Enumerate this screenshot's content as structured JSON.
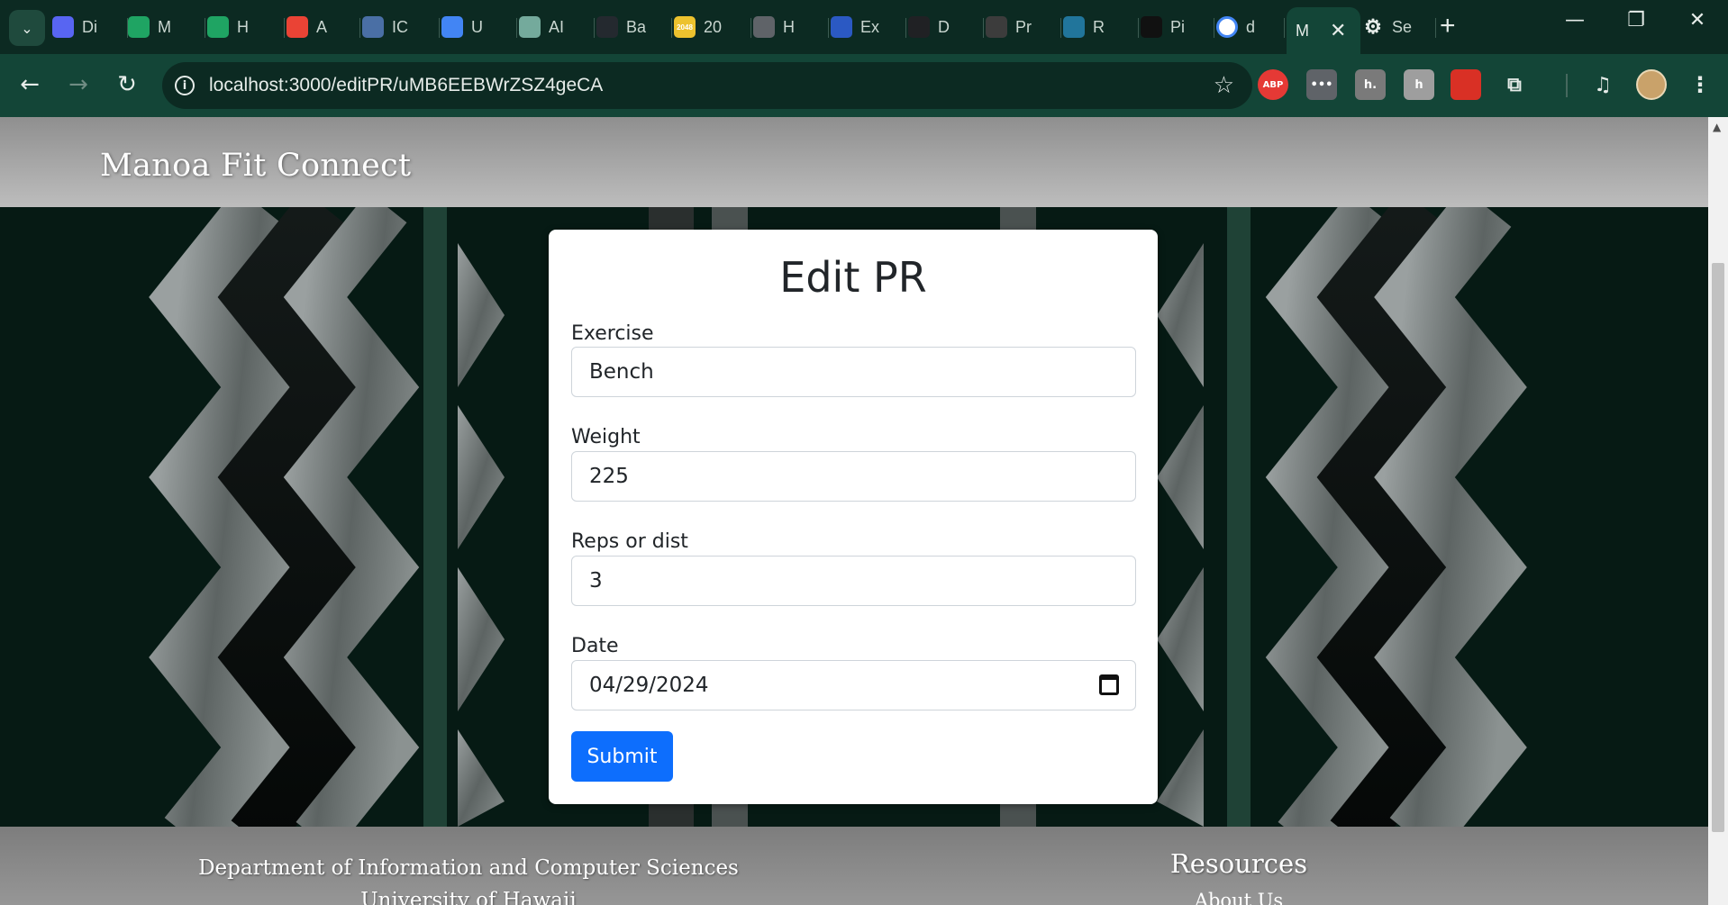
{
  "browser": {
    "tabs": [
      {
        "label": "Di",
        "icon": "discord-icon",
        "color": "#5865f2"
      },
      {
        "label": "M",
        "icon": "google-drive-icon",
        "color": "#1fa463"
      },
      {
        "label": "H",
        "icon": "google-drive-icon",
        "color": "#1fa463"
      },
      {
        "label": "A",
        "icon": "gmail-icon",
        "color": "#ea4335"
      },
      {
        "label": "IC",
        "icon": "document-icon",
        "color": "#4a6fa5"
      },
      {
        "label": "U",
        "icon": "google-docs-icon",
        "color": "#4285f4"
      },
      {
        "label": "AI",
        "icon": "chatgpt-icon",
        "color": "#74aa9c"
      },
      {
        "label": "Ba",
        "icon": "github-icon",
        "color": "#24292f"
      },
      {
        "label": "20",
        "icon": "2048-icon",
        "color": "#edc22e"
      },
      {
        "label": "H",
        "icon": "globe-icon",
        "color": "#5f6368"
      },
      {
        "label": "Ex",
        "icon": "runner-icon",
        "color": "#2b59c3"
      },
      {
        "label": "D",
        "icon": "skull-icon",
        "color": "#202124"
      },
      {
        "label": "Pr",
        "icon": "panther-icon",
        "color": "#3c3c3c"
      },
      {
        "label": "R",
        "icon": "wordpress-icon",
        "color": "#21759b"
      },
      {
        "label": "Pi",
        "icon": "p-icon",
        "color": "#111111"
      },
      {
        "label": "d",
        "icon": "google-icon",
        "color": "#ffffff"
      },
      {
        "label": "M",
        "icon": "active-tab",
        "color": "#134537",
        "active": true
      },
      {
        "label": "Se",
        "icon": "gear-icon",
        "color": "#5f6368"
      }
    ],
    "tab_2048_text": "2048",
    "url": "localhost:3000/editPR/uMB6EEBWrZSZ4geCA",
    "extensions": [
      {
        "name": "adblock-plus-icon",
        "text": "ABP",
        "color": "#e53935"
      },
      {
        "name": "password-dots-icon",
        "text": "•••",
        "color": "#5f6368"
      },
      {
        "name": "honey-icon",
        "text": "h.",
        "color": "#7a7a7a"
      },
      {
        "name": "h-badge-icon",
        "text": "h",
        "color": "#9e9e9e"
      },
      {
        "name": "red-extension-icon",
        "text": "",
        "color": "#d93025"
      },
      {
        "name": "puzzle-icon",
        "text": "",
        "color": "transparent"
      }
    ]
  },
  "site": {
    "brand": "Manoa Fit Connect"
  },
  "form": {
    "title": "Edit PR",
    "exercise_label": "Exercise",
    "exercise_value": "Bench",
    "weight_label": "Weight",
    "weight_value": "225",
    "reps_label": "Reps or dist",
    "reps_value": "3",
    "date_label": "Date",
    "date_value": "04/29/2024",
    "submit_label": "Submit"
  },
  "footer": {
    "dept": "Department of Information and Computer Sciences",
    "university": "University of Hawaii",
    "resources_title": "Resources",
    "about_link": "About Us"
  },
  "colors": {
    "browser_frame": "#0c2a22",
    "browser_toolbar": "#134537",
    "submit_button": "#0d6efd",
    "hero_background": "#061a14"
  }
}
